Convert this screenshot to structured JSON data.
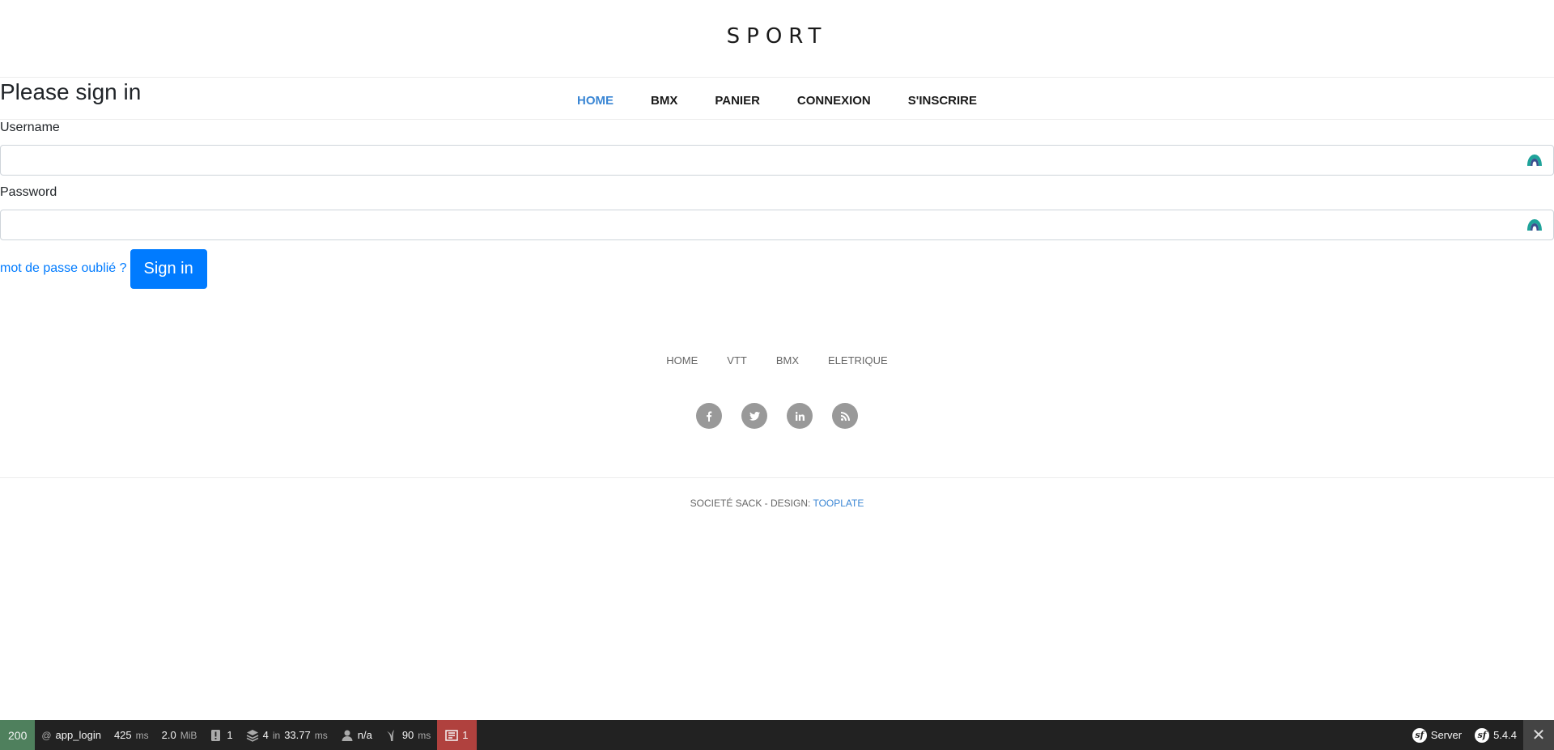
{
  "brand": "SPORT",
  "page_title": "Please sign in",
  "nav": [
    {
      "label": "HOME",
      "active": true
    },
    {
      "label": "BMX",
      "active": false
    },
    {
      "label": "PANIER",
      "active": false
    },
    {
      "label": "CONNEXION",
      "active": false
    },
    {
      "label": "S'INSCRIRE",
      "active": false
    }
  ],
  "form": {
    "username_label": "Username",
    "username_value": "",
    "password_label": "Password",
    "password_value": "",
    "forgot_label": "mot de passe oublié ?",
    "submit_label": "Sign in"
  },
  "footer": {
    "links": [
      "HOME",
      "VTT",
      "BMX",
      "ELETRIQUE"
    ],
    "socials": [
      {
        "icon": "facebook-icon",
        "glyph": "f"
      },
      {
        "icon": "twitter-icon",
        "glyph": "t"
      },
      {
        "icon": "linkedin-icon",
        "glyph": "in"
      },
      {
        "icon": "rss-icon",
        "glyph": "))"
      }
    ],
    "copyright_prefix": "SOCIETÉ SACK - DESIGN: ",
    "copyright_link": "TOOPLATE"
  },
  "toolbar": {
    "status_code": "200",
    "route_at": "@",
    "route": "app_login",
    "time_value": "425",
    "time_unit": "ms",
    "memory_value": "2.0",
    "memory_unit": "MiB",
    "logs_count": "1",
    "cache_calls": "4",
    "cache_in": "in",
    "cache_time": "33.77",
    "cache_unit": "ms",
    "user": "n/a",
    "twig_time": "90",
    "twig_unit": "ms",
    "errors_count": "1",
    "server_label": "Server",
    "symfony_version": "5.4.4",
    "status_color": "#4f805d",
    "error_color": "#b0413e"
  },
  "accent_color": "#007bff"
}
